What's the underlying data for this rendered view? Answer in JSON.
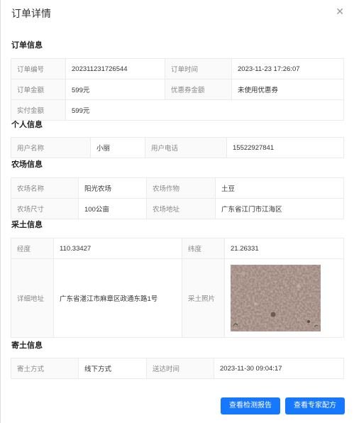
{
  "dialog": {
    "title": "订单详情"
  },
  "order": {
    "section_title": "订单信息",
    "order_no_label": "订单编号",
    "order_no": "202311231726544",
    "order_time_label": "订单时间",
    "order_time": "2023-11-23 17:26:07",
    "amount_label": "订单金额",
    "amount": "599元",
    "coupon_label": "优惠券金额",
    "coupon": "未使用优惠券",
    "paid_label": "实付金额",
    "paid": "599元"
  },
  "personal": {
    "section_title": "个人信息",
    "name_label": "用户名称",
    "name": "小丽",
    "phone_label": "用户电话",
    "phone": "15522927841"
  },
  "farm": {
    "section_title": "农场信息",
    "name_label": "农场名称",
    "name": "阳光农场",
    "crop_label": "农场作物",
    "crop": "土豆",
    "size_label": "农场尺寸",
    "size": "100公亩",
    "address_label": "农场地址",
    "address": "广东省江门市江海区"
  },
  "sampling": {
    "section_title": "采土信息",
    "lon_label": "经度",
    "lon": "110.33427",
    "lat_label": "纬度",
    "lat": "21.26331",
    "address_label": "详细地址",
    "address": "广东省湛江市麻章区政通东路1号",
    "photo_label": "采土照片"
  },
  "mailing": {
    "section_title": "寄土信息",
    "method_label": "寄土方式",
    "method": "线下方式",
    "arrive_label": "送达时间",
    "arrive": "2023-11-30 09:04:17"
  },
  "buttons": {
    "report": "查看检测报告",
    "expert": "查看专家配方"
  }
}
